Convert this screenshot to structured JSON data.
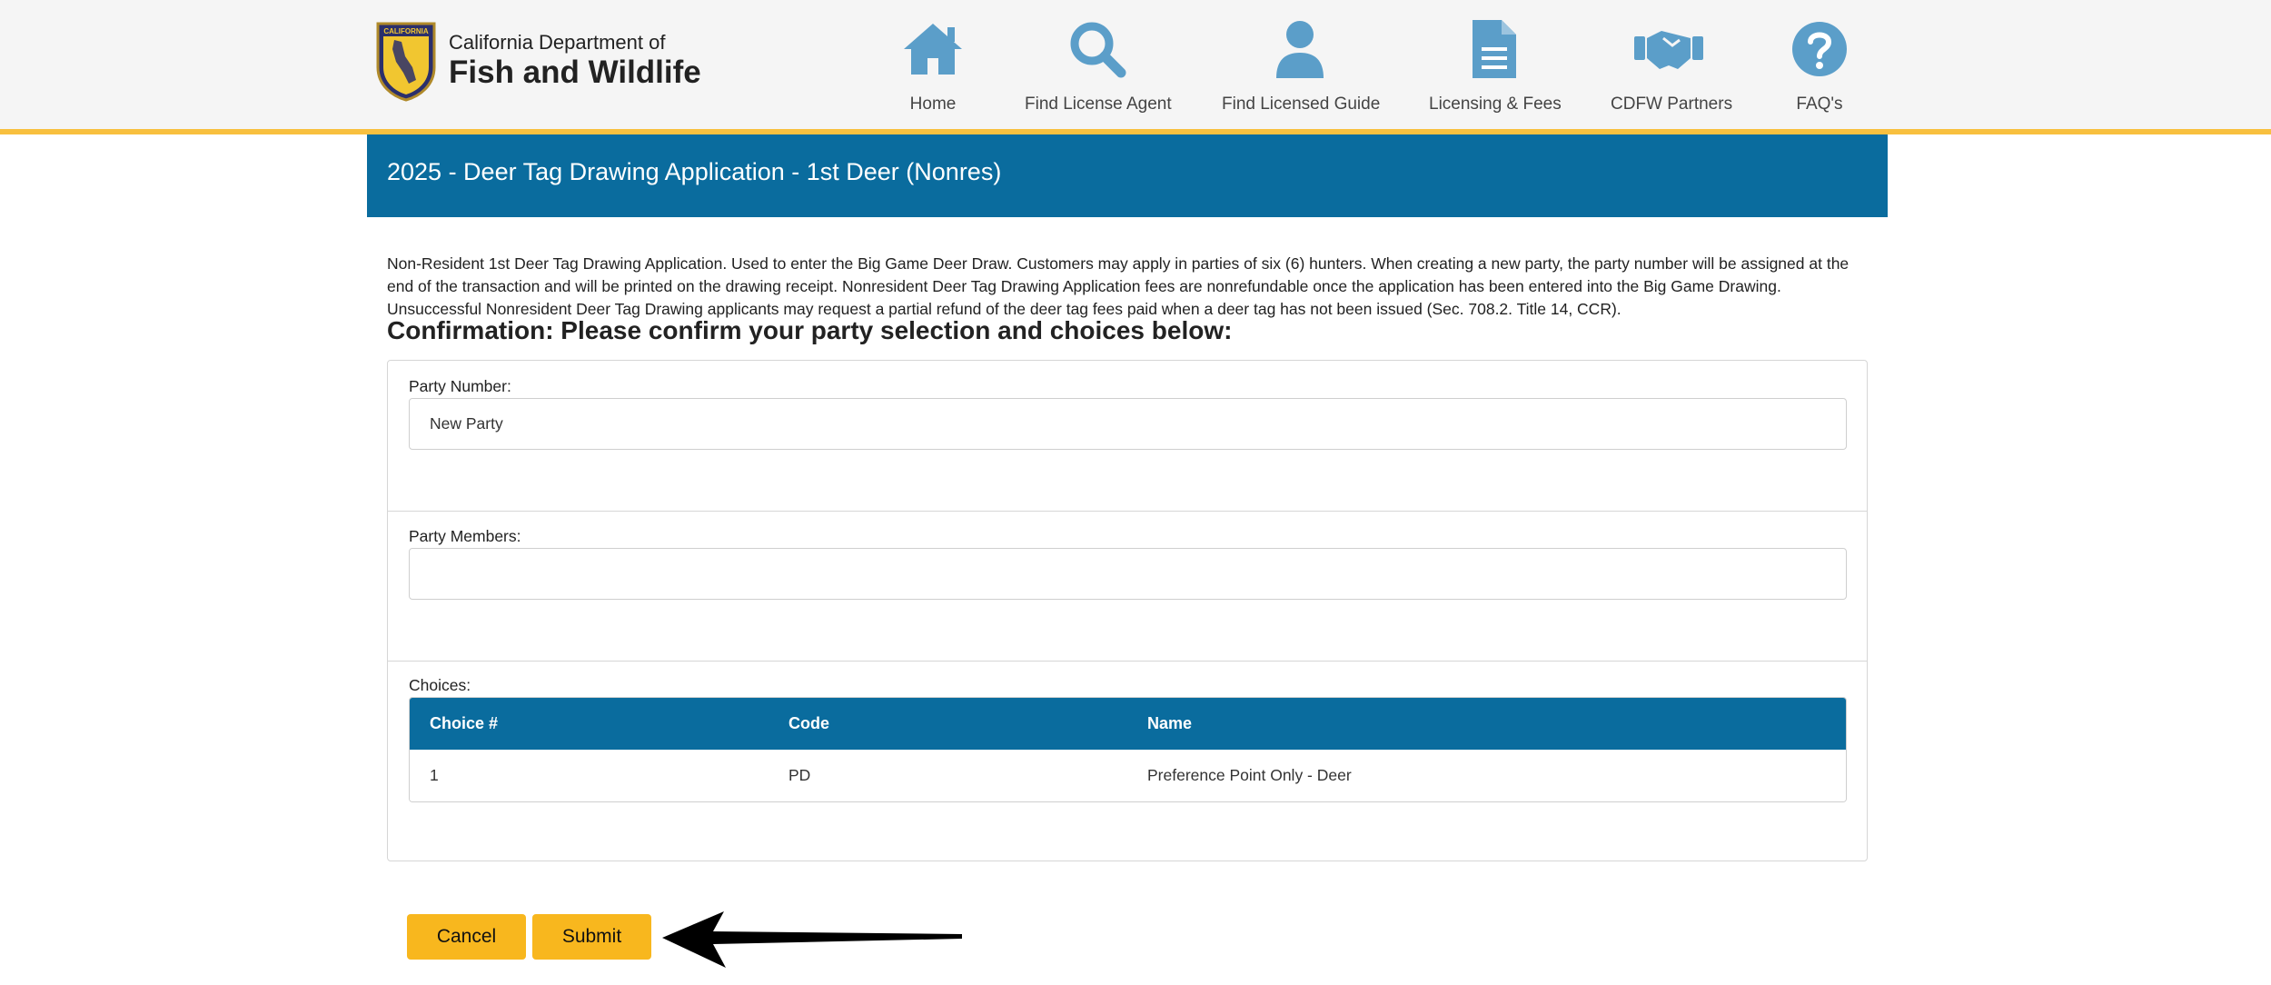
{
  "header": {
    "logo": {
      "badge_text": "CALIFORNIA",
      "line1": "California Department of",
      "line2": "Fish and Wildlife"
    },
    "nav": [
      {
        "label": "Home",
        "icon": "home-icon"
      },
      {
        "label": "Find License Agent",
        "icon": "search-icon"
      },
      {
        "label": "Find Licensed Guide",
        "icon": "person-icon"
      },
      {
        "label": "Licensing & Fees",
        "icon": "document-icon"
      },
      {
        "label": "CDFW Partners",
        "icon": "handshake-icon"
      },
      {
        "label": "FAQ's",
        "icon": "question-icon"
      }
    ]
  },
  "page": {
    "title": "2025 - Deer Tag Drawing Application - 1st Deer (Nonres)",
    "description": "Non-Resident 1st Deer Tag Drawing Application. Used to enter the Big Game Deer Draw. Customers may apply in parties of six (6) hunters. When creating a new party, the party number will be assigned at the end of the transaction and will be printed on the drawing receipt. Nonresident Deer Tag Drawing Application fees are nonrefundable once the application has been entered into the Big Game Drawing. Unsuccessful Nonresident Deer Tag Drawing applicants may request a partial refund of the deer tag fees paid when a deer tag has not been issued (Sec. 708.2. Title 14, CCR).",
    "confirm_heading": "Confirmation: Please confirm your party selection and choices below:"
  },
  "form": {
    "party_number_label": "Party Number:",
    "party_number_value": "New Party",
    "party_members_label": "Party Members:",
    "party_members_value": "",
    "choices_label": "Choices:",
    "choices_columns": [
      "Choice #",
      "Code",
      "Name"
    ],
    "choices_rows": [
      {
        "choice": "1",
        "code": "PD",
        "name": "Preference Point Only - Deer"
      }
    ]
  },
  "actions": {
    "cancel_label": "Cancel",
    "submit_label": "Submit"
  },
  "colors": {
    "brand_blue": "#0a6c9e",
    "accent_yellow": "#f8b71e",
    "nav_icon_blue": "#5b9ec9"
  }
}
